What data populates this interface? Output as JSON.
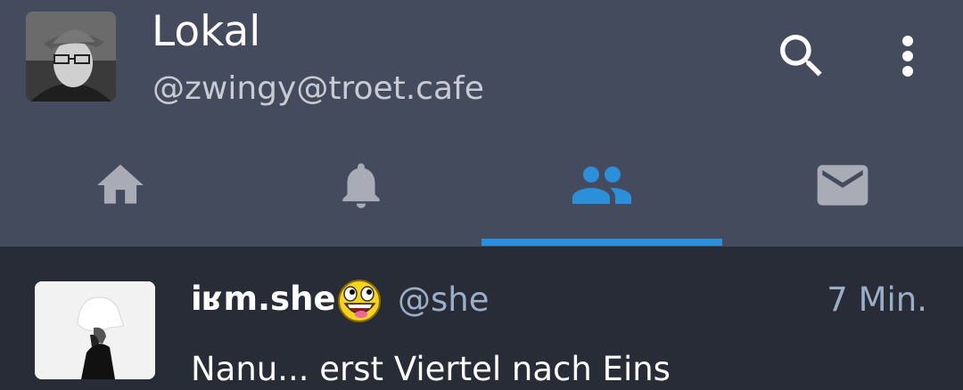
{
  "header": {
    "title": "Lokal",
    "subtitle": "@zwingy@troet.cafe",
    "actions": [
      {
        "icon": "search-icon"
      },
      {
        "icon": "more-vertical-icon"
      }
    ]
  },
  "tabs": [
    {
      "icon": "home-icon",
      "active": false
    },
    {
      "icon": "bell-icon",
      "active": false
    },
    {
      "icon": "people-icon",
      "active": true
    },
    {
      "icon": "mail-icon",
      "active": false
    }
  ],
  "status": {
    "display_name": "iʁm.she",
    "emoji": "awesome-face-emoji",
    "handle": "@she",
    "time": "7 Min.",
    "content": "Nanu... erst Viertel nach Eins"
  },
  "colors": {
    "appbar": "#444b5d",
    "background": "#282c37",
    "accent": "#2b90d9",
    "icon_inactive": "#a9acb7",
    "secondary_text": "#9baec8"
  }
}
